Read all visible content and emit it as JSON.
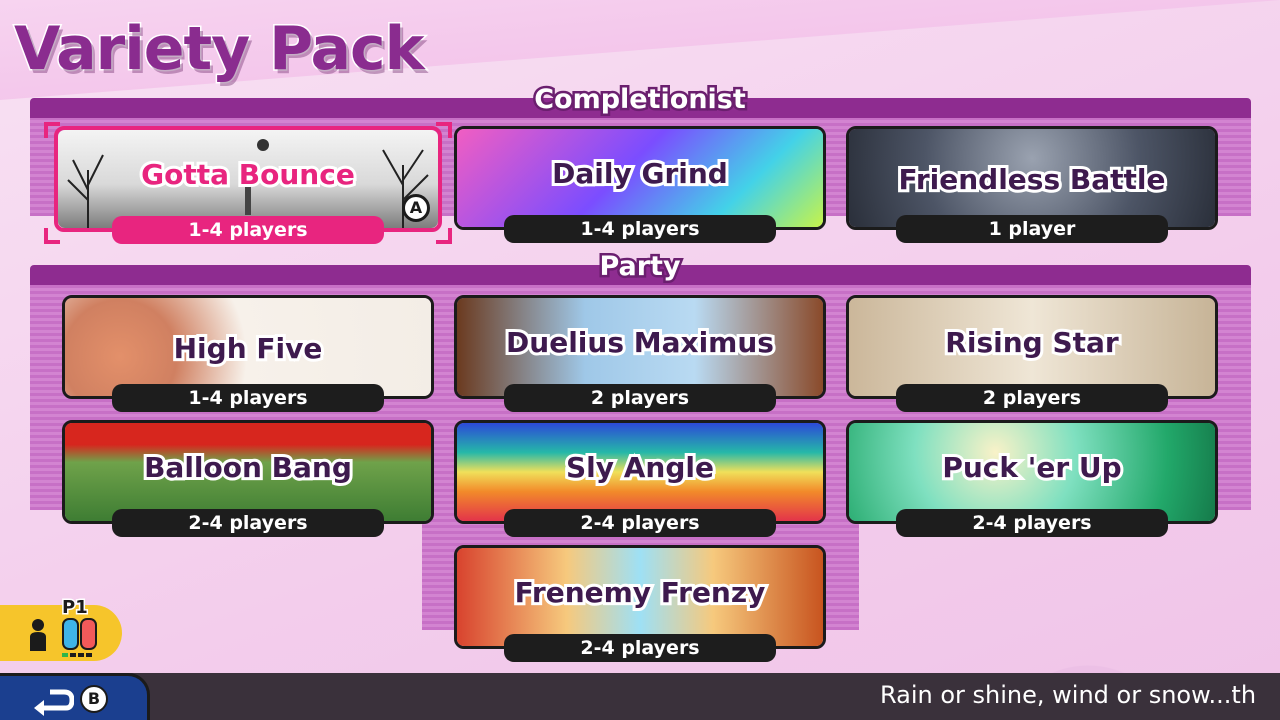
{
  "page": {
    "title": "Variety Pack"
  },
  "sections": [
    {
      "label": "Completionist"
    },
    {
      "label": "Party"
    }
  ],
  "games": [
    {
      "name": "Gotta Bounce",
      "players": "1-4 players",
      "selected": true,
      "confirm_glyph": "A"
    },
    {
      "name": "Daily Grind",
      "players": "1-4 players"
    },
    {
      "name": "Friendless Battle",
      "players": "1 player"
    },
    {
      "name": "High Five",
      "players": "1-4 players"
    },
    {
      "name": "Duelius Maximus",
      "players": "2 players"
    },
    {
      "name": "Rising Star",
      "players": "2 players"
    },
    {
      "name": "Balloon Bang",
      "players": "2-4 players"
    },
    {
      "name": "Sly Angle",
      "players": "2-4 players"
    },
    {
      "name": "Puck 'er Up",
      "players": "2-4 players"
    },
    {
      "name": "Frenemy Frenzy",
      "players": "2-4 players"
    }
  ],
  "player_badge": {
    "label": "P1",
    "icons": [
      "person-icon",
      "joycon-icon"
    ]
  },
  "footer": {
    "back_icon": "back-arrow-icon",
    "back_button_glyph": "B",
    "tip": "Rain or shine, wind or snow...th"
  },
  "colors": {
    "accent": "#e8257f",
    "section_bar": "#8e2c90",
    "title": "#8a2c8f",
    "badge": "#f6c52b",
    "footer": "#3a313b"
  }
}
